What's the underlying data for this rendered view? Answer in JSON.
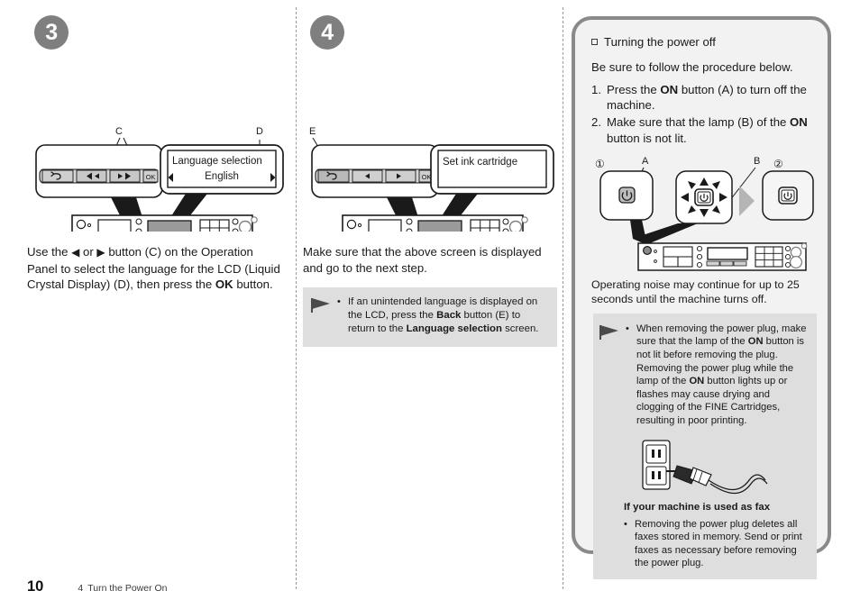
{
  "steps": [
    {
      "number": "3",
      "labels": {
        "c": "C",
        "d": "D"
      },
      "lcd": {
        "line1": "Language selection",
        "line2": "English"
      },
      "panel_keys": {
        "back": "back-arrow",
        "left": "◀",
        "right": "▶",
        "ok": "OK"
      },
      "body_pre": "Use the ",
      "body_mid": " or ",
      "body_post": " button (C) on the Operation Panel to select the language for the LCD (Liquid Crystal Display) (D), then press the ",
      "body_bold": "OK",
      "body_end": " button."
    },
    {
      "number": "4",
      "labels": {
        "e": "E"
      },
      "lcd": {
        "line1": "Set ink cartridge"
      },
      "panel_keys": {
        "back": "back-arrow",
        "left": "◀",
        "right": "▶",
        "ok": "OK"
      },
      "body": "Make sure that the above screen is displayed and go to the next step.",
      "tip": {
        "part1": "If an unintended language is displayed on the LCD, press the ",
        "bold1": "Back",
        "part2": " button (E) to return to the ",
        "bold2": "Language selection",
        "part3": " screen."
      }
    }
  ],
  "note_panel": {
    "heading": "Turning the power off",
    "lead": "Be sure to follow the procedure below.",
    "items": [
      {
        "n": "1.",
        "part1": "Press the ",
        "bold": "ON",
        "part2": " button (A) to turn off the machine."
      },
      {
        "n": "2.",
        "part1": "Make sure that the lamp (B) of the ",
        "bold": "ON",
        "part2": " button is not lit."
      }
    ],
    "diagram_labels": {
      "circle1": "①",
      "circle2": "②",
      "a": "A",
      "b": "B"
    },
    "after_text": "Operating noise may continue for up to 25 seconds until the machine turns off.",
    "warning": {
      "part1": "When removing the power plug, make sure that the lamp of the ",
      "bold1": "ON",
      "part2": " button is not lit before removing the plug. Removing the power plug while the lamp of the ",
      "bold2": "ON",
      "part3": " button lights up or flashes may cause drying and clogging of the FINE Cartridges, resulting in poor printing."
    },
    "fax_heading": "If your machine is used as fax",
    "fax_text": "Removing the power plug deletes all faxes stored in memory. Send or print faxes as necessary before removing the power plug."
  },
  "footer": {
    "page_number": "10",
    "section_number": "4",
    "section_title": "Turn the Power On"
  },
  "colors": {
    "badge_gray": "#7f7f7f",
    "panel_border": "#8a8a8a",
    "panel_bg": "#f2f2f2",
    "note_bg": "#dedede",
    "text": "#1a1a1a"
  }
}
